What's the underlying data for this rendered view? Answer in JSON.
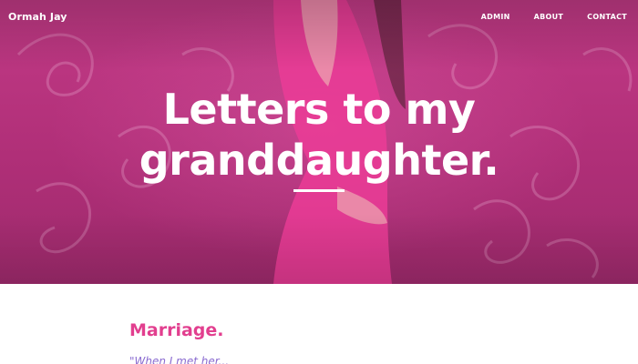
{
  "brand": "Ormah Jay",
  "nav": {
    "items": [
      {
        "label": "ADMIN"
      },
      {
        "label": "ABOUT"
      },
      {
        "label": "CONTACT"
      }
    ]
  },
  "hero": {
    "title_line1": "Letters to my",
    "title_line2": "granddaughter."
  },
  "content": {
    "heading": "Marriage.",
    "teaser": "\"When I met her..."
  },
  "colors": {
    "hero_pink": "#c23a86",
    "heading_pink": "#e23f8f",
    "teaser_purple": "#8a6bd0"
  }
}
